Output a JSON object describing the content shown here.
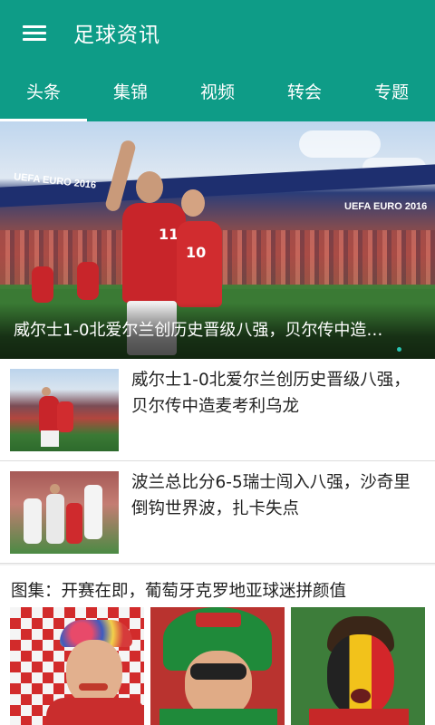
{
  "appbar": {
    "title": "足球资讯",
    "menu_icon": "hamburger-menu-icon"
  },
  "tabs": [
    {
      "label": "头条",
      "active": true
    },
    {
      "label": "集锦",
      "active": false
    },
    {
      "label": "视频",
      "active": false
    },
    {
      "label": "转会",
      "active": false
    },
    {
      "label": "专题",
      "active": false
    }
  ],
  "hero": {
    "caption": "威尔士1-0北爱尔兰创历史晋级八强，贝尔传中造…",
    "banner_text": "UEFA EURO 2016",
    "player_numbers": [
      "11",
      "10"
    ]
  },
  "news": [
    {
      "title": "威尔士1-0北爱尔兰创历史晋级八强，贝尔传中造麦考利乌龙"
    },
    {
      "title": "波兰总比分6-5瑞士闯入八强，沙奇里倒钩世界波，扎卡失点"
    }
  ],
  "gallery": {
    "title": "图集：开赛在即，葡萄牙克罗地亚球迷拼颜值"
  },
  "colors": {
    "primary": "#0e9c87",
    "indicator_dot": "#29c4b2"
  }
}
